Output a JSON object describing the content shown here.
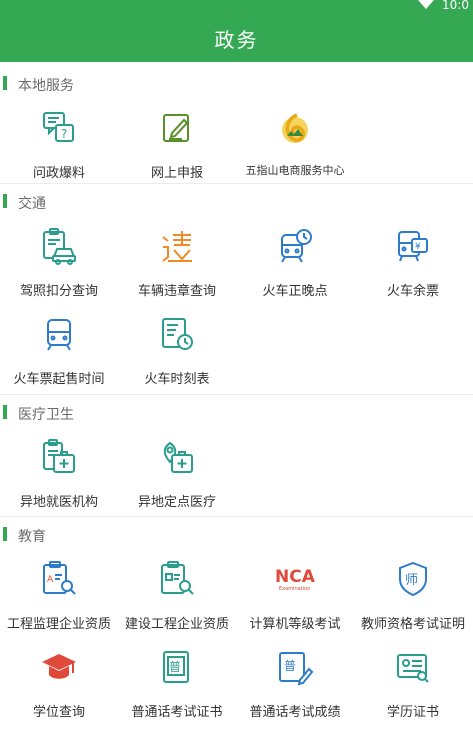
{
  "status": {
    "time": "10:0"
  },
  "header": {
    "title": "政务"
  },
  "sections": [
    {
      "title": "本地服务",
      "items": [
        {
          "label": "问政爆料",
          "icon": "chat-question-icon"
        },
        {
          "label": "网上申报",
          "icon": "edit-document-icon"
        },
        {
          "label": "五指山电商服务中心",
          "icon": "wuzhishan-logo-icon"
        }
      ]
    },
    {
      "title": "交通",
      "items": [
        {
          "label": "驾照扣分查询",
          "icon": "driver-license-car-icon"
        },
        {
          "label": "车辆违章查询",
          "icon": "traffic-violation-icon"
        },
        {
          "label": "火车正晚点",
          "icon": "train-clock-icon"
        },
        {
          "label": "火车余票",
          "icon": "train-ticket-icon"
        },
        {
          "label": "火车票起售时间",
          "icon": "train-icon"
        },
        {
          "label": "火车时刻表",
          "icon": "train-timetable-icon"
        }
      ]
    },
    {
      "title": "医疗卫生",
      "items": [
        {
          "label": "异地就医机构",
          "icon": "medical-kit-clipboard-icon"
        },
        {
          "label": "异地定点医疗",
          "icon": "medical-location-icon"
        }
      ]
    },
    {
      "title": "教育",
      "items": [
        {
          "label": "工程监理企业资质",
          "icon": "engineering-search-icon"
        },
        {
          "label": "建设工程企业资质",
          "icon": "construction-search-icon"
        },
        {
          "label": "计算机等级考试",
          "icon": "nca-exam-icon"
        },
        {
          "label": "教师资格考试证明",
          "icon": "teacher-shield-icon"
        },
        {
          "label": "学位查询",
          "icon": "graduation-cap-icon"
        },
        {
          "label": "普通话考试证书",
          "icon": "mandarin-certificate-icon"
        },
        {
          "label": "普通话考试成绩",
          "icon": "mandarin-score-icon"
        },
        {
          "label": "学历证书",
          "icon": "diploma-icon"
        }
      ]
    }
  ],
  "colors": {
    "brand": "#35a853",
    "icon_teal": "#2a9d8f",
    "icon_orange": "#f08a24",
    "icon_red": "#e0493a",
    "icon_blue": "#2e7cc9"
  }
}
